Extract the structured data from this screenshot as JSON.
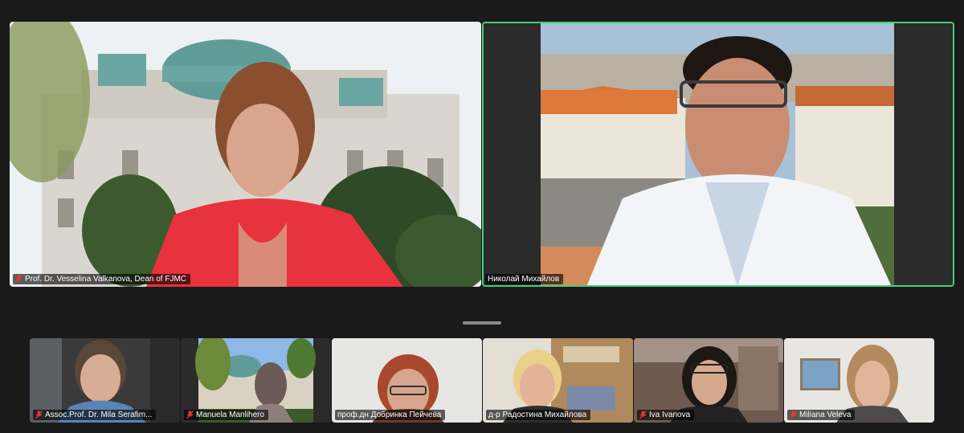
{
  "main": {
    "speakers": [
      {
        "name": "Prof. Dr. Vesselina Valkanova, Dean of FJMC",
        "muted": true
      },
      {
        "name": "Николай Михайлов",
        "muted": false
      }
    ]
  },
  "gallery": {
    "participants": [
      {
        "name": "Assoc.Prof. Dr. Mila Serafim...",
        "muted": true
      },
      {
        "name": "Manuela Manlihero",
        "muted": true
      },
      {
        "name": "проф.дн Добринка Пейчева",
        "muted": false
      },
      {
        "name": "д-р Радостина Михайлова",
        "muted": false
      },
      {
        "name": "Iva Ivanova",
        "muted": true
      },
      {
        "name": "Miliana Veleva",
        "muted": true
      }
    ]
  },
  "colors": {
    "background": "#1a1a1a",
    "active_speaker_border": "#3fd07a",
    "mute_icon": "#e53935"
  }
}
